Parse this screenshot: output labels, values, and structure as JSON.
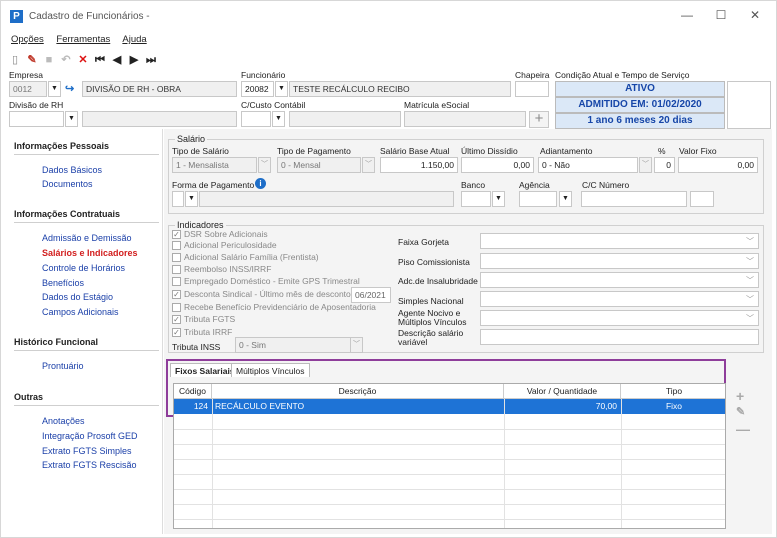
{
  "window": {
    "title": "Cadastro de Funcionários -",
    "app_icon": "P"
  },
  "menu": {
    "opcoes": "Opções",
    "ferramentas": "Ferramentas",
    "ajuda": "Ajuda"
  },
  "header": {
    "empresa_label": "Empresa",
    "empresa_code": "0012",
    "empresa_name": "DIVISÃO DE RH - OBRA",
    "funcionario_label": "Funcionário",
    "funcionario_code": "20082",
    "funcionario_name": "TESTE RECÁLCULO RECIBO",
    "chapeira_label": "Chapeira",
    "condicao_label": "Condição Atual e Tempo de Serviço",
    "status": "ATIVO",
    "admitido": "ADMITIDO EM: 01/02/2020",
    "tempo": "1 ano 6 meses 20 dias",
    "divisao_label": "Divisão de RH",
    "ccusto_label": "C/Custo Contábil",
    "matricula_label": "Matrícula eSocial"
  },
  "sidebar": {
    "sections": [
      {
        "title": "Informações Pessoais",
        "items": [
          "Dados Básicos",
          "Documentos"
        ]
      },
      {
        "title": "Informações Contratuais",
        "items": [
          "Admissão e Demissão",
          "Salários e Indicadores",
          "Controle de Horários",
          "Benefícios",
          "Dados do Estágio",
          "Campos Adicionais"
        ]
      },
      {
        "title": "Histórico Funcional",
        "items": [
          "Prontuário"
        ]
      },
      {
        "title": "Outras",
        "items": [
          "Anotações",
          "Integração Prosoft GED",
          "Extrato FGTS Simples",
          "Extrato FGTS Rescisão"
        ]
      }
    ],
    "active_item": "Salários e Indicadores"
  },
  "salario": {
    "group_title": "Salário",
    "tipo_label": "Tipo de Salário",
    "tipo_value": "1 - Mensalista",
    "tipo_pag_label": "Tipo de Pagamento",
    "tipo_pag_value": "0 - Mensal",
    "base_label": "Salário Base Atual",
    "base_value": "1.150,00",
    "dissidio_label": "Último Dissídio",
    "dissidio_value": "0,00",
    "adiant_label": "Adiantamento",
    "adiant_value": "0 - Não",
    "pct_label": "%",
    "pct_value": "0",
    "fixo_label": "Valor Fixo",
    "fixo_value": "0,00",
    "forma_label": "Forma de Pagamento",
    "banco_label": "Banco",
    "agencia_label": "Agência",
    "cc_label": "C/C Número"
  },
  "indicadores": {
    "group_title": "Indicadores",
    "checks": [
      {
        "label": "DSR Sobre Adicionais",
        "checked": true
      },
      {
        "label": "Adicional Periculosidade",
        "checked": false
      },
      {
        "label": "Adicional Salário Família (Frentista)",
        "checked": false
      },
      {
        "label": "Reembolso INSS/IRRF",
        "checked": false
      },
      {
        "label": "Empregado Doméstico - Emite GPS Trimestral",
        "checked": false
      },
      {
        "label": "Desconta Sindical - Último mês de desconto",
        "checked": true
      },
      {
        "label": "Recebe Benefício Previdenciário de Aposentadoria",
        "checked": false
      },
      {
        "label": "Tributa FGTS",
        "checked": true
      },
      {
        "label": "Tributa IRRF",
        "checked": true
      }
    ],
    "sindical_month": "06/2021",
    "inss_label": "Tributa INSS",
    "inss_value": "0 - Sim",
    "right_labels": [
      "Faixa Gorjeta",
      "Piso Comissionista",
      "Adc.de Insalubridade",
      "Simples Nacional",
      "Agente Nocivo e Múltiplos Vínculos",
      "Descrição salário variável"
    ]
  },
  "tabs": [
    "Fixos Salariais",
    "Múltiplos Vínculos"
  ],
  "grid": {
    "headers": [
      "Código",
      "Descrição",
      "Valor / Quantidade",
      "Tipo"
    ],
    "rows": [
      {
        "codigo": "124",
        "descricao": "RECÁLCULO EVENTO",
        "valor": "70,00",
        "tipo": "Fixo"
      }
    ]
  },
  "colors": {
    "accent": "#1e73d6",
    "highlight_border": "#8e3d9a",
    "link": "#1a3fa8",
    "active_link": "#d21e1e",
    "status_bg": "#dbe8f7"
  }
}
